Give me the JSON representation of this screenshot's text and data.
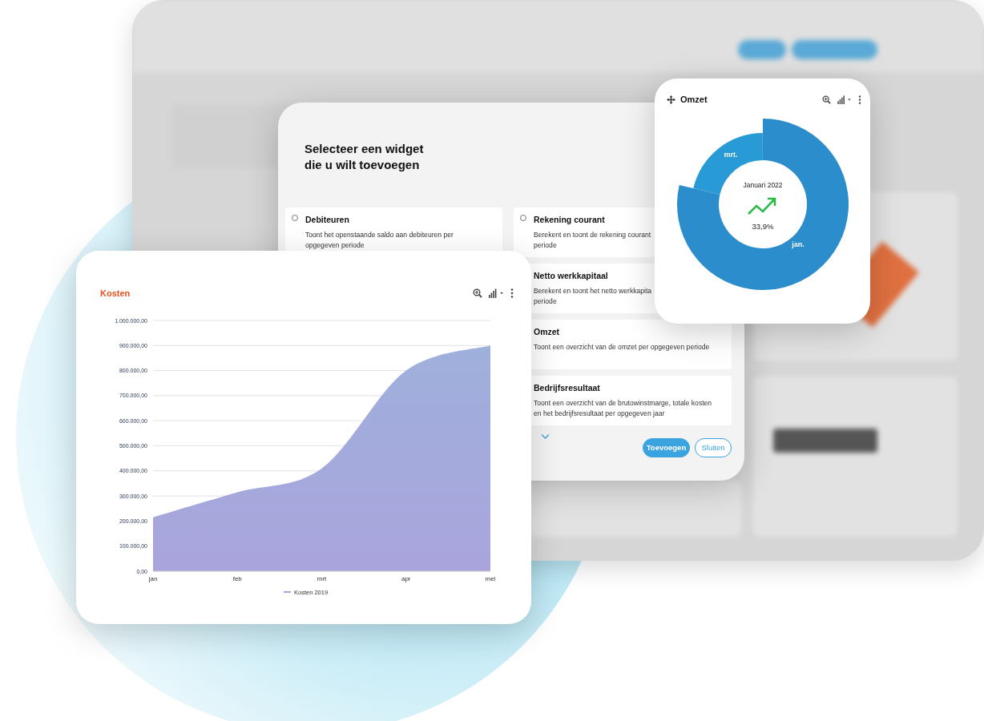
{
  "dialog": {
    "title_lines": [
      "Selecteer een widget",
      "die u wilt toevoegen"
    ],
    "columns": [
      [
        {
          "title": "Debiteuren",
          "selected": false,
          "description_lines": [
            "Toont het openstaande saldo aan debiteuren per",
            "opgegeven periode"
          ]
        }
      ],
      [
        {
          "title": "Rekening courant",
          "selected": false,
          "description_lines": [
            "Berekent en toont de rekening courant",
            "periode"
          ]
        },
        {
          "title": "Netto werkkapitaal",
          "description_lines": [
            "Berekent en toont het netto werkkapita",
            "periode"
          ]
        },
        {
          "title": "Omzet",
          "description_lines": [
            "Toont een overzicht van de omzet per opgegeven periode"
          ]
        },
        {
          "title": "Bedrijfsresultaat",
          "description_lines": [
            "Toont een overzicht van de brutowinstmarge, totale kosten",
            "en het bedrijfsresultaat per opgegeven jaar"
          ]
        }
      ]
    ],
    "buttons": [
      {
        "label": "Toevoegen",
        "kind": "primary"
      },
      {
        "label": "Sluiten",
        "kind": "outline"
      }
    ]
  },
  "kosten_card": {
    "title": "Kosten",
    "chart_data": {
      "type": "area",
      "categories": [
        "jan",
        "feb",
        "mrt",
        "apr",
        "mei"
      ],
      "series": [
        {
          "name": "Kosten 2019",
          "color": "#a9a4dc",
          "values": [
            215000,
            315000,
            410000,
            800000,
            900000
          ]
        }
      ],
      "ylim": [
        0,
        1000000
      ],
      "grid": true,
      "yticks": [
        {
          "value": 0,
          "label": "0,00"
        },
        {
          "value": 100000,
          "label": "100.000,00"
        },
        {
          "value": 200000,
          "label": "200.000,00"
        },
        {
          "value": 300000,
          "label": "300.000,00"
        },
        {
          "value": 400000,
          "label": "400.000,00"
        },
        {
          "value": 500000,
          "label": "500.000,00"
        },
        {
          "value": 600000,
          "label": "600.000,00"
        },
        {
          "value": 700000,
          "label": "700.000,00"
        },
        {
          "value": 800000,
          "label": "800.000,00"
        },
        {
          "value": 900000,
          "label": "900.000,00"
        },
        {
          "value": 1000000,
          "label": "1.000.000,00"
        }
      ]
    }
  },
  "omzet_card": {
    "title": "Omzet",
    "slice_labels": [
      "mrt.",
      "jan."
    ],
    "center_title": "Januari 2022",
    "center_value": "33,9%"
  }
}
